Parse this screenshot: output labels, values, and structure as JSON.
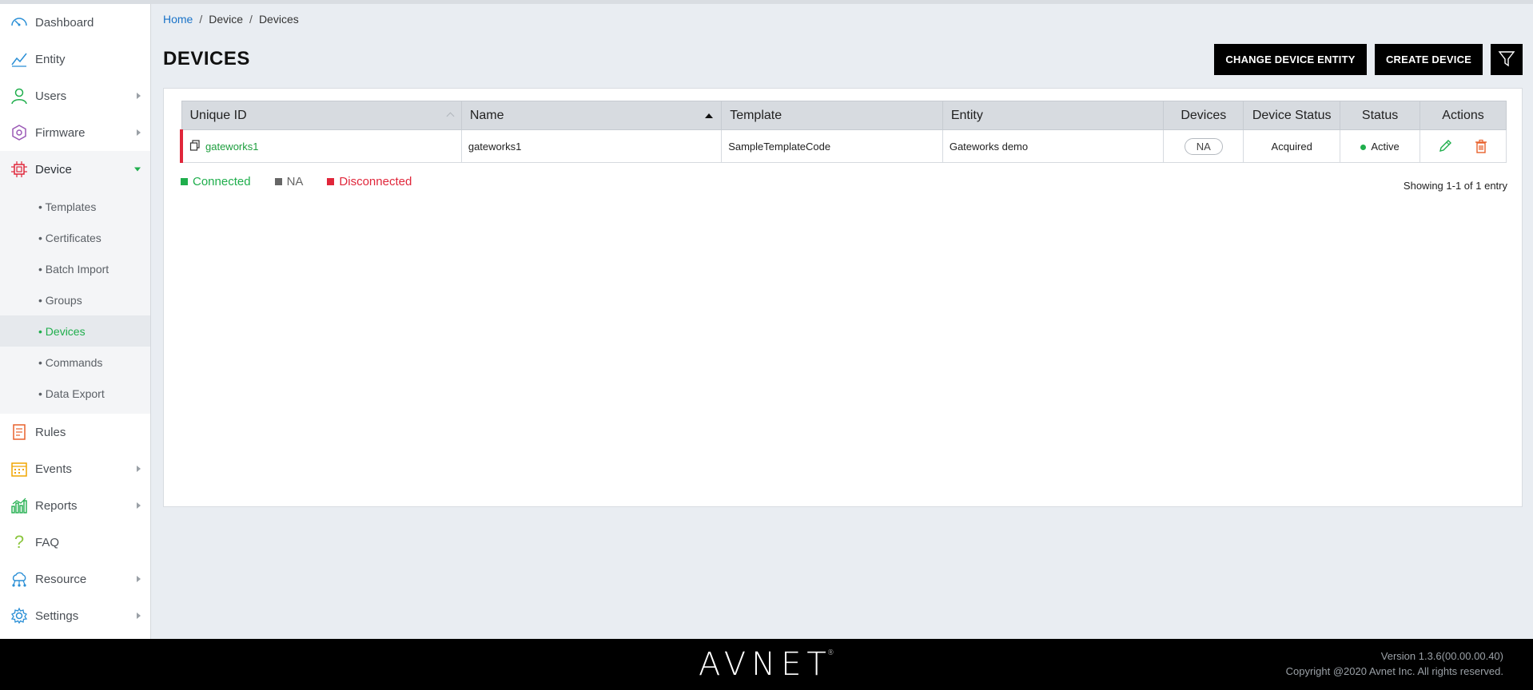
{
  "sidebar": {
    "items": [
      {
        "label": "Dashboard"
      },
      {
        "label": "Entity"
      },
      {
        "label": "Users"
      },
      {
        "label": "Firmware"
      },
      {
        "label": "Device"
      },
      {
        "label": "Rules"
      },
      {
        "label": "Events"
      },
      {
        "label": "Reports"
      },
      {
        "label": "FAQ"
      },
      {
        "label": "Resource"
      },
      {
        "label": "Settings"
      }
    ],
    "device_submenu": [
      {
        "label": "• Templates"
      },
      {
        "label": "• Certificates"
      },
      {
        "label": "• Batch Import"
      },
      {
        "label": "• Groups"
      },
      {
        "label": "• Devices"
      },
      {
        "label": "• Commands"
      },
      {
        "label": "• Data Export"
      }
    ]
  },
  "breadcrumb": {
    "home": "Home",
    "sep": "/",
    "section": "Device",
    "current": "Devices"
  },
  "header": {
    "title": "DEVICES",
    "change_entity_label": "CHANGE DEVICE ENTITY",
    "create_label": "CREATE DEVICE"
  },
  "table": {
    "columns": [
      "Unique ID",
      "Name",
      "Template",
      "Entity",
      "Devices",
      "Device Status",
      "Status",
      "Actions"
    ],
    "rows": [
      {
        "unique_id": "gateworks1",
        "name": "gateworks1",
        "template": "SampleTemplateCode",
        "entity": "Gateworks demo",
        "devices": "NA",
        "device_status": "Acquired",
        "status": "Active"
      }
    ]
  },
  "legend": {
    "connected": "Connected",
    "na": "NA",
    "disconnected": "Disconnected"
  },
  "pagination": {
    "showing": "Showing 1-1 of 1 entry"
  },
  "footer": {
    "logo": "AVNET",
    "version": "Version 1.3.6(00.00.00.40)",
    "copyright": "Copyright @2020 Avnet Inc. All rights reserved."
  },
  "colors": {
    "accent_green": "#1fae4c",
    "link_blue": "#1a73c8",
    "disconnected_red": "#e0263a",
    "na_gray": "#666666",
    "delete_orange": "#e8612c"
  }
}
